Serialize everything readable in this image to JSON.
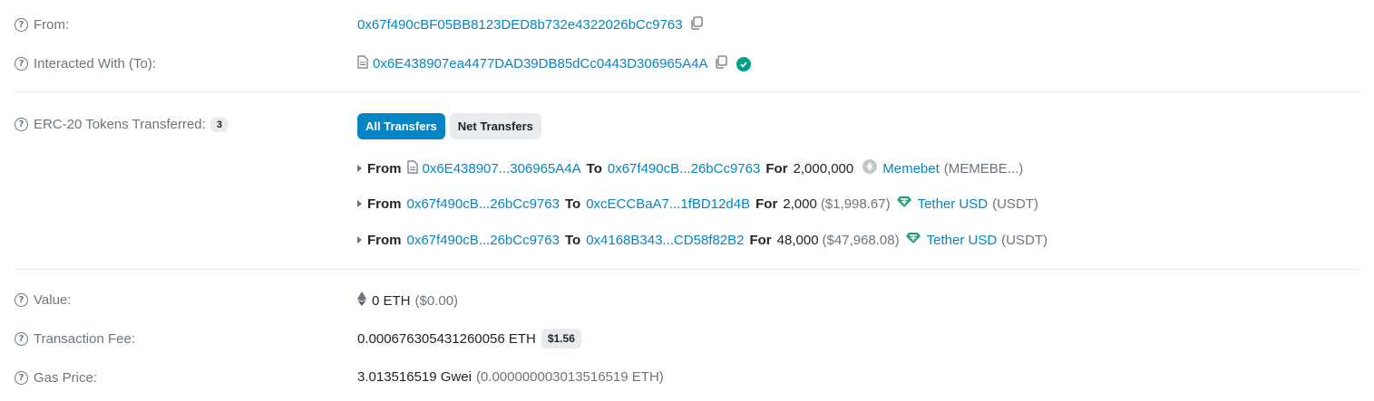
{
  "from": {
    "label": "From:",
    "address": "0x67f490cBF05BB8123DED8b732e4322026bCc9763"
  },
  "interacted": {
    "label": "Interacted With (To):",
    "address": "0x6E438907ea4477DAD39DB85dCc0443D306965A4A"
  },
  "erc20": {
    "label": "ERC-20 Tokens Transferred:",
    "count": "3",
    "tabs": [
      "All Transfers",
      "Net Transfers"
    ],
    "transfers": [
      {
        "from_kw": "From",
        "from": "0x6E438907...306965A4A",
        "to_kw": "To",
        "to": "0x67f490cB...26bCc9763",
        "for_kw": "For",
        "amount": "2,000,000",
        "usd": "",
        "token_name": "Memebet",
        "token_symbol": "(MEMEBE...)",
        "token_icon": "memebet-token-icon"
      },
      {
        "from_kw": "From",
        "from": "0x67f490cB...26bCc9763",
        "to_kw": "To",
        "to": "0xcECCBaA7...1fBD12d4B",
        "for_kw": "For",
        "amount": "2,000",
        "usd": "($1,998.67)",
        "token_name": "Tether USD",
        "token_symbol": "(USDT)",
        "token_icon": "tether-icon"
      },
      {
        "from_kw": "From",
        "from": "0x67f490cB...26bCc9763",
        "to_kw": "To",
        "to": "0x4168B343...CD58f82B2",
        "for_kw": "For",
        "amount": "48,000",
        "usd": "($47,968.08)",
        "token_name": "Tether USD",
        "token_symbol": "(USDT)",
        "token_icon": "tether-icon"
      }
    ]
  },
  "value": {
    "label": "Value:",
    "amount": "0 ETH",
    "usd": "($0.00)"
  },
  "fee": {
    "label": "Transaction Fee:",
    "amount": "0.000676305431260056 ETH",
    "usd": "$1.56"
  },
  "gas": {
    "label": "Gas Price:",
    "amount": "3.013516519 Gwei",
    "eth": "(0.000000003013516519 ETH)"
  },
  "colors": {
    "link": "#0784c3",
    "verified": "#00a186",
    "tether": "#26a17b",
    "muted": "#6c757d"
  }
}
